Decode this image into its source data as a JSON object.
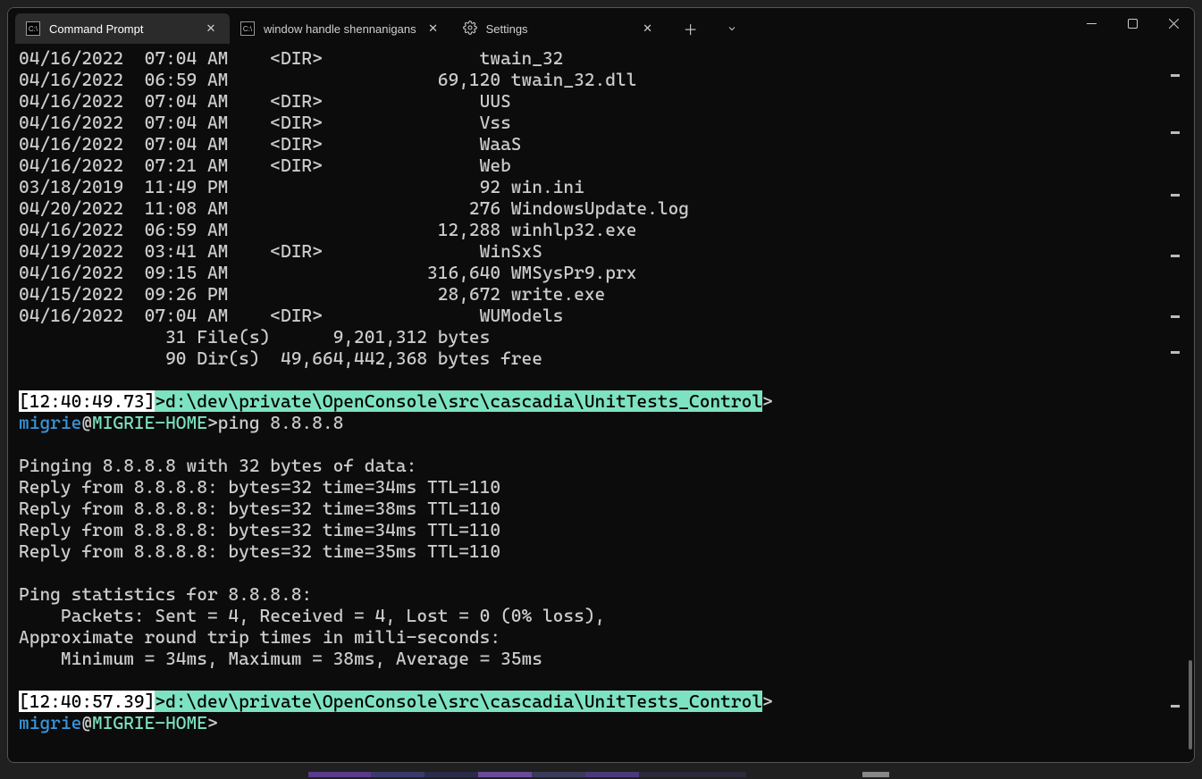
{
  "tabs": [
    {
      "title": "Command Prompt",
      "icon": "cmd"
    },
    {
      "title": "window handle shennanigans",
      "icon": "cmd"
    },
    {
      "title": "Settings",
      "icon": "gear"
    }
  ],
  "dirListing": [
    {
      "date": "04/16/2022",
      "time": "07:04 AM",
      "dir": "<DIR>",
      "size": "",
      "name": "twain_32"
    },
    {
      "date": "04/16/2022",
      "time": "06:59 AM",
      "dir": "",
      "size": "69,120",
      "name": "twain_32.dll"
    },
    {
      "date": "04/16/2022",
      "time": "07:04 AM",
      "dir": "<DIR>",
      "size": "",
      "name": "UUS"
    },
    {
      "date": "04/16/2022",
      "time": "07:04 AM",
      "dir": "<DIR>",
      "size": "",
      "name": "Vss"
    },
    {
      "date": "04/16/2022",
      "time": "07:04 AM",
      "dir": "<DIR>",
      "size": "",
      "name": "WaaS"
    },
    {
      "date": "04/16/2022",
      "time": "07:21 AM",
      "dir": "<DIR>",
      "size": "",
      "name": "Web"
    },
    {
      "date": "03/18/2019",
      "time": "11:49 PM",
      "dir": "",
      "size": "92",
      "name": "win.ini"
    },
    {
      "date": "04/20/2022",
      "time": "11:08 AM",
      "dir": "",
      "size": "276",
      "name": "WindowsUpdate.log"
    },
    {
      "date": "04/16/2022",
      "time": "06:59 AM",
      "dir": "",
      "size": "12,288",
      "name": "winhlp32.exe"
    },
    {
      "date": "04/19/2022",
      "time": "03:41 AM",
      "dir": "<DIR>",
      "size": "",
      "name": "WinSxS"
    },
    {
      "date": "04/16/2022",
      "time": "09:15 AM",
      "dir": "",
      "size": "316,640",
      "name": "WMSysPr9.prx"
    },
    {
      "date": "04/15/2022",
      "time": "09:26 PM",
      "dir": "",
      "size": "28,672",
      "name": "write.exe"
    },
    {
      "date": "04/16/2022",
      "time": "07:04 AM",
      "dir": "<DIR>",
      "size": "",
      "name": "WUModels"
    }
  ],
  "summary": {
    "files_line": "              31 File(s)      9,201,312 bytes",
    "dirs_line": "              90 Dir(s)  49,664,442,368 bytes free"
  },
  "prompt1": {
    "time": "[12:40:49.73]",
    "gt": ">",
    "path": "d:\\dev\\private\\OpenConsole\\src\\cascadia\\UnitTests_Control",
    "tail": ">",
    "user": "migrie",
    "at": "@",
    "host": "MIGRIE-HOME",
    "end": ">",
    "command": "ping 8.8.8.8"
  },
  "ping_output": [
    "",
    "Pinging 8.8.8.8 with 32 bytes of data:",
    "Reply from 8.8.8.8: bytes=32 time=34ms TTL=110",
    "Reply from 8.8.8.8: bytes=32 time=38ms TTL=110",
    "Reply from 8.8.8.8: bytes=32 time=34ms TTL=110",
    "Reply from 8.8.8.8: bytes=32 time=35ms TTL=110",
    "",
    "Ping statistics for 8.8.8.8:",
    "    Packets: Sent = 4, Received = 4, Lost = 0 (0% loss),",
    "Approximate round trip times in milli-seconds:",
    "    Minimum = 34ms, Maximum = 38ms, Average = 35ms",
    ""
  ],
  "prompt2": {
    "time": "[12:40:57.39]",
    "gt": ">",
    "path": "d:\\dev\\private\\OpenConsole\\src\\cascadia\\UnitTests_Control",
    "tail": ">",
    "user": "migrie",
    "at": "@",
    "host": "MIGRIE-HOME",
    "end": ">"
  },
  "minimap_marks": [
    24,
    88,
    158,
    226,
    294,
    334,
    730
  ]
}
